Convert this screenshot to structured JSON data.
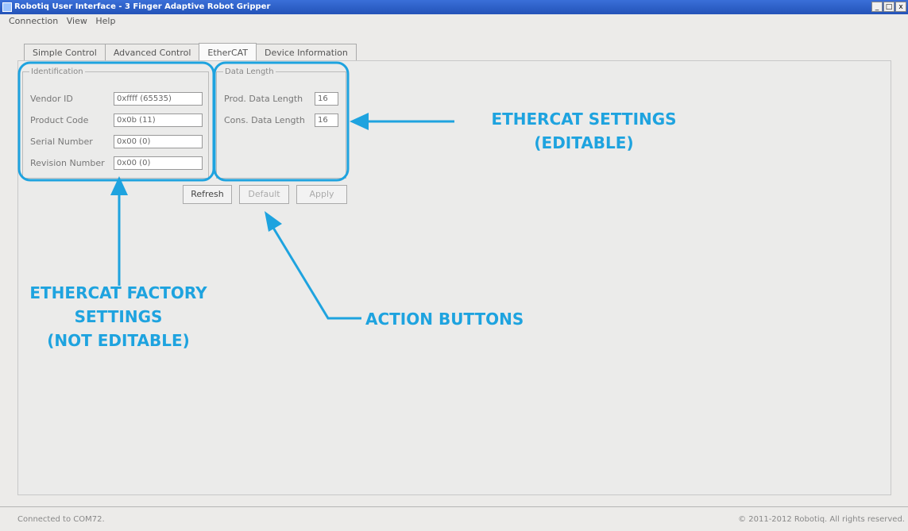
{
  "window": {
    "title": "Robotiq User Interface - 3 Finger Adaptive Robot Gripper",
    "controls": [
      "_",
      "□",
      "x"
    ]
  },
  "menu": [
    "Connection",
    "View",
    "Help"
  ],
  "tabs": [
    {
      "label": "Simple Control",
      "active": false
    },
    {
      "label": "Advanced Control",
      "active": false
    },
    {
      "label": "EtherCAT",
      "active": true
    },
    {
      "label": "Device Information",
      "active": false
    }
  ],
  "identification": {
    "legend": "Identification",
    "rows": [
      {
        "label": "Vendor ID",
        "value": "0xffff (65535)"
      },
      {
        "label": "Product Code",
        "value": "0x0b (11)"
      },
      {
        "label": "Serial Number",
        "value": "0x00 (0)"
      },
      {
        "label": "Revision Number",
        "value": "0x00 (0)"
      }
    ]
  },
  "data_length": {
    "legend": "Data Length",
    "rows": [
      {
        "label": "Prod. Data Length",
        "value": "16"
      },
      {
        "label": "Cons. Data Length",
        "value": "16"
      }
    ]
  },
  "buttons": {
    "refresh": "Refresh",
    "default": "Default",
    "apply": "Apply"
  },
  "annotations": {
    "ethercat_settings": [
      "ETHERCAT SETTINGS",
      "(EDITABLE)"
    ],
    "factory_settings": [
      "ETHERCAT FACTORY",
      "SETTINGS",
      "(NOT EDITABLE)"
    ],
    "action_buttons": "ACTION BUTTONS",
    "accent_color": "#1ea3df"
  },
  "status": {
    "left": "Connected to COM72.",
    "right": "© 2011-2012 Robotiq. All rights reserved."
  }
}
